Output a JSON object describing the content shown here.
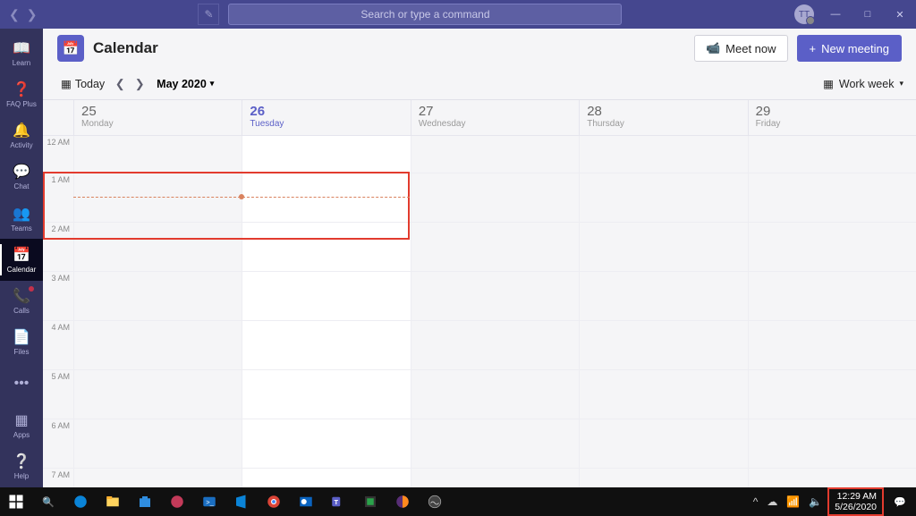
{
  "titlebar": {
    "search_placeholder": "Search or type a command",
    "avatar_initials": "TT"
  },
  "rail": {
    "items": [
      {
        "label": "Learn"
      },
      {
        "label": "FAQ Plus"
      },
      {
        "label": "Activity"
      },
      {
        "label": "Chat"
      },
      {
        "label": "Teams"
      },
      {
        "label": "Calendar"
      },
      {
        "label": "Calls"
      },
      {
        "label": "Files"
      }
    ],
    "more": "•••",
    "apps": "Apps",
    "help": "Help"
  },
  "header": {
    "title": "Calendar",
    "meet_now": "Meet now",
    "new_meeting": "New meeting"
  },
  "toolbar": {
    "today": "Today",
    "month": "May 2020",
    "view": "Work week"
  },
  "days": [
    {
      "num": "25",
      "name": "Monday"
    },
    {
      "num": "26",
      "name": "Tuesday"
    },
    {
      "num": "27",
      "name": "Wednesday"
    },
    {
      "num": "28",
      "name": "Thursday"
    },
    {
      "num": "29",
      "name": "Friday"
    }
  ],
  "hours": [
    "12 AM",
    "1 AM",
    "2 AM",
    "3 AM",
    "4 AM",
    "5 AM",
    "6 AM",
    "7 AM"
  ],
  "taskbar": {
    "time": "12:29 AM",
    "date": "5/26/2020"
  }
}
